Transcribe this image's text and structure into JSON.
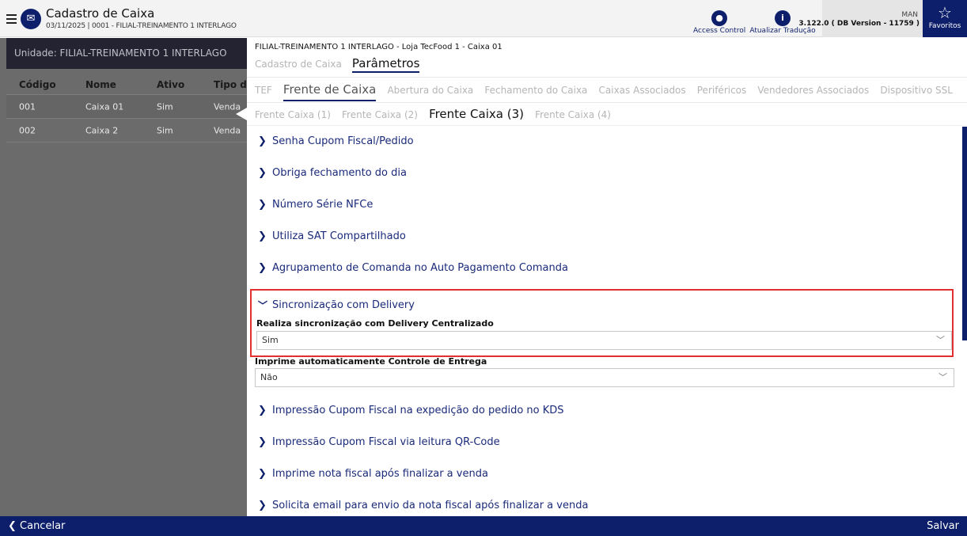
{
  "header": {
    "title": "Cadastro de Caixa",
    "subtitle": "03/11/2025 | 0001 - FILIAL-TREINAMENTO 1 INTERLAGO",
    "access_control": "Access Control",
    "update_translation": "Atualizar Tradução",
    "user": "MAN",
    "version": "3.122.0 ( DB Version - 11759 )",
    "favorites": "Favoritos"
  },
  "left": {
    "unit": "Unidade: FILIAL-TREINAMENTO 1 INTERLAGO",
    "columns": [
      "Código",
      "Nome",
      "Ativo",
      "Tipo do"
    ],
    "rows": [
      [
        "001",
        "Caixa 01",
        "Sim",
        "Venda"
      ],
      [
        "002",
        "Caixa 2",
        "Sim",
        "Venda"
      ]
    ]
  },
  "right": {
    "breadcrumb": "FILIAL-TREINAMENTO 1 INTERLAGO - Loja TecFood 1 - Caixa 01",
    "top_tabs": [
      "Cadastro de Caixa",
      "Parâmetros"
    ],
    "sub_tabs": [
      "TEF",
      "Frente de Caixa",
      "Abertura do Caixa",
      "Fechamento do Caixa",
      "Caixas Associados",
      "Periféricos",
      "Vendedores Associados",
      "Dispositivo SSL"
    ],
    "sub2_tabs": [
      "Frente Caixa (1)",
      "Frente Caixa (2)",
      "Frente Caixa (3)",
      "Frente Caixa (4)"
    ],
    "sections_top": [
      "Senha Cupom Fiscal/Pedido",
      "Obriga fechamento do dia",
      "Número Série NFCe",
      "Utiliza SAT Compartilhado",
      "Agrupamento de Comanda no Auto Pagamento Comanda"
    ],
    "expanded": {
      "title": "Sincronização com Delivery",
      "field1_label": "Realiza sincronização com Delivery Centralizado",
      "field1_value": "Sim",
      "field2_label": "Imprime automaticamente Controle de Entrega",
      "field2_value": "Não"
    },
    "sections_bottom": [
      "Impressão Cupom Fiscal na expedição do pedido no KDS",
      "Impressão Cupom Fiscal via leitura QR-Code",
      "Imprime nota fiscal após finalizar a venda",
      "Solicita email para envio da nota fiscal após finalizar a venda"
    ]
  },
  "footer": {
    "cancel": "❮ Cancelar",
    "save": "Salvar"
  }
}
